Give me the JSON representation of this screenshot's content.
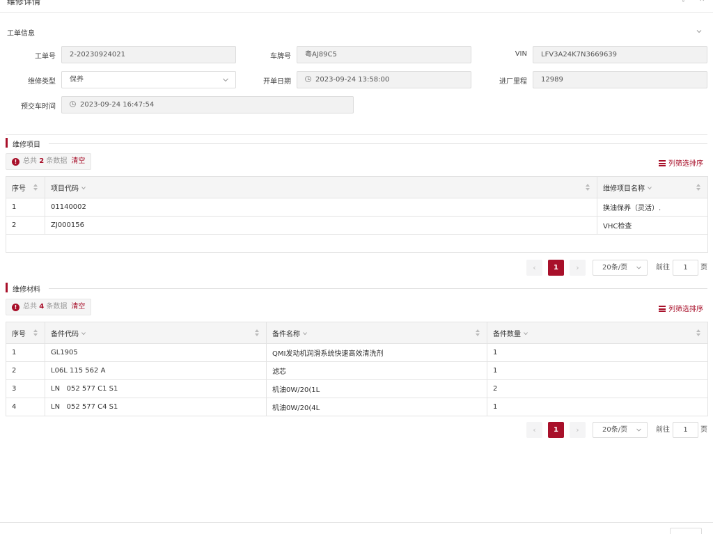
{
  "window": {
    "title": "维修详情",
    "ctrl_left": "⤢",
    "ctrl_right": "✕"
  },
  "section": {
    "title": "工单信息"
  },
  "fields": {
    "order_no": {
      "label": "工单号",
      "value": "2-20230924021"
    },
    "plate": {
      "label": "车牌号",
      "value": "粤AJ89C5"
    },
    "vin": {
      "label": "VIN",
      "value": "LFV3A24K7N3669639"
    },
    "repair_type": {
      "label": "维修类型",
      "value": "保养"
    },
    "open_date": {
      "label": "开单日期",
      "value": "2023-09-24 13:58:00"
    },
    "mileage": {
      "label": "进厂里程",
      "value": "12989"
    },
    "delivery_time": {
      "label": "预交车时间",
      "value": "2023-09-24 16:47:54"
    }
  },
  "items_section": {
    "title": "维修项目",
    "count_prefix": "总共",
    "count": "2",
    "count_suffix": "条数据",
    "clear_label": "清空",
    "filter_label": "列筛选排序",
    "columns": [
      "序号",
      "项目代码",
      "维修项目名称"
    ],
    "rows": [
      [
        "1",
        "01140002",
        "换油保养（灵活）."
      ],
      [
        "2",
        "ZJ000156",
        "VHC检查"
      ]
    ]
  },
  "materials_section": {
    "title": "维修材料",
    "count_prefix": "总共",
    "count": "4",
    "count_suffix": "条数据",
    "clear_label": "清空",
    "filter_label": "列筛选排序",
    "columns": [
      "序号",
      "备件代码",
      "备件名称",
      "备件数量"
    ],
    "rows": [
      [
        "1",
        "GL1905",
        "QMI发动机润滑系统快速高效清洗剂",
        "1"
      ],
      [
        "2",
        "L06L 115 562 A",
        "滤芯",
        "1"
      ],
      [
        "3",
        "LN   052 577 C1 S1",
        "机油0W/20(1L",
        "2"
      ],
      [
        "4",
        "LN   052 577 C4 S1",
        "机油0W/20(4L",
        "1"
      ]
    ]
  },
  "pagination": {
    "prev": "‹",
    "next": "›",
    "current": "1",
    "page_size": "20条/页",
    "goto_label": "前往",
    "goto_value": "1",
    "page_suffix": "页"
  },
  "colors": {
    "accent": "#a8102a"
  }
}
